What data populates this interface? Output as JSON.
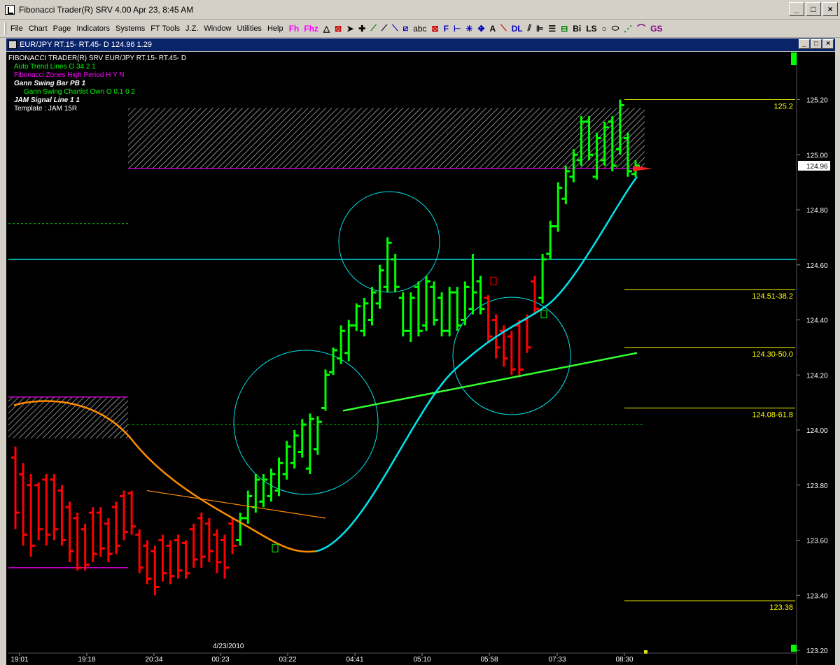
{
  "window": {
    "title": "Fibonacci Trader(R) SRV 4.00 Apr 23,  8:45 AM",
    "buttons": [
      "_",
      "□",
      "×"
    ]
  },
  "menu": {
    "items": [
      "File",
      "Chart",
      "Page",
      "Indicators",
      "Systems",
      "FT Tools",
      "J.Z.",
      "Window",
      "Utilities",
      "Help"
    ],
    "tools": [
      "Fh",
      "Fhz",
      "abc",
      "F",
      "A",
      "DL",
      "Bi",
      "LS",
      "GS"
    ]
  },
  "child_window": {
    "title": "EUR/JPY RT.15- RT.45- D  124.96  1.29"
  },
  "legend": {
    "header": "FIBONACCI TRADER(R) SRV    EUR/JPY RT.15- RT.45- D",
    "lines": [
      {
        "text": "Auto Trend Lines O 34 2 1",
        "color": "#00ff00"
      },
      {
        "text": "Fibonacci Zones High Period H Y N",
        "color": "#ff00ff"
      },
      {
        "text": "Gann Swing Bar PB 1",
        "color": "#ffffff"
      },
      {
        "text": "Gann Swing Chartist Own O 0.1 0 2",
        "color": "#00ff00"
      },
      {
        "text": "JAM Signal Line 1 1",
        "color": "#ffffff"
      },
      {
        "text": "Template : JAM 15R",
        "color": "#ffffff"
      }
    ]
  },
  "chart_data": {
    "type": "bar",
    "title": "",
    "ylim": [
      123.2,
      125.28
    ],
    "y_ticks": [
      "125.20",
      "125.00",
      "124.80",
      "124.60",
      "124.40",
      "124.20",
      "124.00",
      "123.80",
      "123.60",
      "123.40",
      "123.20"
    ],
    "x_ticks": [
      "19:01",
      "19:18",
      "20:34",
      "00:23",
      "03:22",
      "04:41",
      "05:10",
      "05:58",
      "07:33",
      "08:30"
    ],
    "date_label": "4/23/2010",
    "current_price": "124.96",
    "fib_levels": [
      {
        "label": "125.2",
        "value": 125.2
      },
      {
        "label": "124.51-38.2",
        "value": 124.51
      },
      {
        "label": "124.30-50.0",
        "value": 124.3
      },
      {
        "label": "124.08-61.8",
        "value": 124.08
      },
      {
        "label": "123.38",
        "value": 123.38
      }
    ],
    "horizontal_line": 124.62,
    "colors": {
      "up": "#00ff00",
      "down": "#ff0000",
      "signal": "#00e5ee",
      "orange": "#ff8c00",
      "fib": "#ffff00"
    },
    "bars": [
      {
        "h": 123.94,
        "l": 123.64,
        "o": 123.9,
        "c": 123.7,
        "color": "down"
      },
      {
        "h": 123.88,
        "l": 123.58,
        "o": 123.84,
        "c": 123.62,
        "color": "down"
      },
      {
        "h": 123.84,
        "l": 123.54,
        "o": 123.8,
        "c": 123.58,
        "color": "down"
      },
      {
        "h": 123.81,
        "l": 123.6,
        "o": 123.8,
        "c": 123.64,
        "color": "down"
      },
      {
        "h": 123.84,
        "l": 123.58,
        "o": 123.82,
        "c": 123.62,
        "color": "down"
      },
      {
        "h": 123.84,
        "l": 123.6,
        "o": 123.82,
        "c": 123.64,
        "color": "down"
      },
      {
        "h": 123.8,
        "l": 123.58,
        "o": 123.78,
        "c": 123.6,
        "color": "down"
      },
      {
        "h": 123.74,
        "l": 123.52,
        "o": 123.72,
        "c": 123.56,
        "color": "down"
      },
      {
        "h": 123.7,
        "l": 123.49,
        "o": 123.68,
        "c": 123.5,
        "color": "down"
      },
      {
        "h": 123.66,
        "l": 123.49,
        "o": 123.64,
        "c": 123.51,
        "color": "down"
      },
      {
        "h": 123.72,
        "l": 123.52,
        "o": 123.7,
        "c": 123.55,
        "color": "down"
      },
      {
        "h": 123.72,
        "l": 123.54,
        "o": 123.7,
        "c": 123.57,
        "color": "down"
      },
      {
        "h": 123.68,
        "l": 123.52,
        "o": 123.66,
        "c": 123.55,
        "color": "down"
      },
      {
        "h": 123.74,
        "l": 123.55,
        "o": 123.72,
        "c": 123.58,
        "color": "down"
      },
      {
        "h": 123.78,
        "l": 123.6,
        "o": 123.76,
        "c": 123.63,
        "color": "down"
      },
      {
        "h": 123.78,
        "l": 123.62,
        "o": 123.77,
        "c": 123.65,
        "color": "down"
      },
      {
        "h": 123.64,
        "l": 123.48,
        "o": 123.62,
        "c": 123.5,
        "color": "down"
      },
      {
        "h": 123.6,
        "l": 123.44,
        "o": 123.58,
        "c": 123.46,
        "color": "down"
      },
      {
        "h": 123.58,
        "l": 123.4,
        "o": 123.56,
        "c": 123.43,
        "color": "down"
      },
      {
        "h": 123.62,
        "l": 123.45,
        "o": 123.6,
        "c": 123.48,
        "color": "down"
      },
      {
        "h": 123.6,
        "l": 123.44,
        "o": 123.58,
        "c": 123.47,
        "color": "down"
      },
      {
        "h": 123.62,
        "l": 123.46,
        "o": 123.6,
        "c": 123.49,
        "color": "down"
      },
      {
        "h": 123.6,
        "l": 123.46,
        "o": 123.59,
        "c": 123.48,
        "color": "down"
      },
      {
        "h": 123.66,
        "l": 123.5,
        "o": 123.64,
        "c": 123.53,
        "color": "down"
      },
      {
        "h": 123.7,
        "l": 123.5,
        "o": 123.68,
        "c": 123.54,
        "color": "down"
      },
      {
        "h": 123.68,
        "l": 123.52,
        "o": 123.66,
        "c": 123.56,
        "color": "down"
      },
      {
        "h": 123.64,
        "l": 123.48,
        "o": 123.62,
        "c": 123.52,
        "color": "down"
      },
      {
        "h": 123.62,
        "l": 123.46,
        "o": 123.6,
        "c": 123.5,
        "color": "down"
      },
      {
        "h": 123.68,
        "l": 123.55,
        "o": 123.66,
        "c": 123.58,
        "color": "down"
      },
      {
        "h": 123.7,
        "l": 123.58,
        "o": 123.6,
        "c": 123.68,
        "color": "up"
      },
      {
        "h": 123.78,
        "l": 123.66,
        "o": 123.68,
        "c": 123.76,
        "color": "up"
      },
      {
        "h": 123.84,
        "l": 123.7,
        "o": 123.72,
        "c": 123.82,
        "color": "up"
      },
      {
        "h": 123.84,
        "l": 123.72,
        "o": 123.74,
        "c": 123.82,
        "color": "up"
      },
      {
        "h": 123.86,
        "l": 123.74,
        "o": 123.76,
        "c": 123.84,
        "color": "up"
      },
      {
        "h": 123.9,
        "l": 123.76,
        "o": 123.78,
        "c": 123.88,
        "color": "up"
      },
      {
        "h": 123.96,
        "l": 123.82,
        "o": 123.84,
        "c": 123.94,
        "color": "up"
      },
      {
        "h": 124.0,
        "l": 123.86,
        "o": 123.88,
        "c": 123.98,
        "color": "up"
      },
      {
        "h": 124.04,
        "l": 123.9,
        "o": 123.92,
        "c": 124.02,
        "color": "up"
      },
      {
        "h": 124.06,
        "l": 123.84,
        "o": 123.86,
        "c": 124.04,
        "color": "up"
      },
      {
        "h": 124.05,
        "l": 123.91,
        "o": 123.93,
        "c": 124.03,
        "color": "up"
      },
      {
        "h": 124.22,
        "l": 124.07,
        "o": 124.08,
        "c": 124.2,
        "color": "up"
      },
      {
        "h": 124.3,
        "l": 124.2,
        "o": 124.21,
        "c": 124.29,
        "color": "up"
      },
      {
        "h": 124.38,
        "l": 124.24,
        "o": 124.26,
        "c": 124.36,
        "color": "up"
      },
      {
        "h": 124.4,
        "l": 124.25,
        "o": 124.28,
        "c": 124.38,
        "color": "up"
      },
      {
        "h": 124.46,
        "l": 124.36,
        "o": 124.38,
        "c": 124.45,
        "color": "up"
      },
      {
        "h": 124.48,
        "l": 124.34,
        "o": 124.36,
        "c": 124.46,
        "color": "up"
      },
      {
        "h": 124.52,
        "l": 124.38,
        "o": 124.4,
        "c": 124.5,
        "color": "up"
      },
      {
        "h": 124.6,
        "l": 124.44,
        "o": 124.46,
        "c": 124.58,
        "color": "up"
      },
      {
        "h": 124.7,
        "l": 124.5,
        "o": 124.52,
        "c": 124.68,
        "color": "up"
      },
      {
        "h": 124.64,
        "l": 124.5,
        "o": 124.62,
        "c": 124.52,
        "color": "up"
      },
      {
        "h": 124.5,
        "l": 124.34,
        "o": 124.48,
        "c": 124.36,
        "color": "up"
      },
      {
        "h": 124.5,
        "l": 124.32,
        "o": 124.36,
        "c": 124.48,
        "color": "up"
      },
      {
        "h": 124.54,
        "l": 124.34,
        "o": 124.52,
        "c": 124.36,
        "color": "up"
      },
      {
        "h": 124.56,
        "l": 124.36,
        "o": 124.38,
        "c": 124.54,
        "color": "up"
      },
      {
        "h": 124.54,
        "l": 124.38,
        "o": 124.52,
        "c": 124.4,
        "color": "up"
      },
      {
        "h": 124.5,
        "l": 124.34,
        "o": 124.48,
        "c": 124.36,
        "color": "up"
      },
      {
        "h": 124.52,
        "l": 124.34,
        "o": 124.36,
        "c": 124.5,
        "color": "up"
      },
      {
        "h": 124.52,
        "l": 124.36,
        "o": 124.5,
        "c": 124.38,
        "color": "up"
      },
      {
        "h": 124.54,
        "l": 124.38,
        "o": 124.4,
        "c": 124.52,
        "color": "up"
      },
      {
        "h": 124.64,
        "l": 124.42,
        "o": 124.44,
        "c": 124.5,
        "color": "up"
      },
      {
        "h": 124.56,
        "l": 124.42,
        "o": 124.54,
        "c": 124.44,
        "color": "up"
      },
      {
        "h": 124.49,
        "l": 124.32,
        "o": 124.48,
        "c": 124.34,
        "color": "down"
      },
      {
        "h": 124.42,
        "l": 124.26,
        "o": 124.4,
        "c": 124.3,
        "color": "down"
      },
      {
        "h": 124.38,
        "l": 124.23,
        "o": 124.36,
        "c": 124.26,
        "color": "down"
      },
      {
        "h": 124.36,
        "l": 124.2,
        "o": 124.34,
        "c": 124.22,
        "color": "down"
      },
      {
        "h": 124.4,
        "l": 124.2,
        "o": 124.38,
        "c": 124.22,
        "color": "down"
      },
      {
        "h": 124.42,
        "l": 124.28,
        "o": 124.4,
        "c": 124.3,
        "color": "down"
      },
      {
        "h": 124.56,
        "l": 124.42,
        "o": 124.54,
        "c": 124.44,
        "color": "down"
      },
      {
        "h": 124.64,
        "l": 124.46,
        "o": 124.48,
        "c": 124.62,
        "color": "up"
      },
      {
        "h": 124.76,
        "l": 124.62,
        "o": 124.64,
        "c": 124.74,
        "color": "up"
      },
      {
        "h": 124.9,
        "l": 124.72,
        "o": 124.74,
        "c": 124.88,
        "color": "up"
      },
      {
        "h": 124.96,
        "l": 124.82,
        "o": 124.84,
        "c": 124.94,
        "color": "up"
      },
      {
        "h": 125.02,
        "l": 124.9,
        "o": 124.92,
        "c": 125.0,
        "color": "up"
      },
      {
        "h": 125.14,
        "l": 124.96,
        "o": 124.98,
        "c": 125.12,
        "color": "up"
      },
      {
        "h": 125.14,
        "l": 124.98,
        "o": 125.12,
        "c": 125.0,
        "color": "up"
      },
      {
        "h": 125.08,
        "l": 124.91,
        "o": 124.92,
        "c": 125.06,
        "color": "up"
      },
      {
        "h": 125.12,
        "l": 124.96,
        "o": 124.98,
        "c": 125.1,
        "color": "up"
      },
      {
        "h": 125.14,
        "l": 124.94,
        "o": 125.12,
        "c": 124.96,
        "color": "up"
      },
      {
        "h": 125.2,
        "l": 125.0,
        "o": 125.02,
        "c": 125.18,
        "color": "up"
      },
      {
        "h": 125.08,
        "l": 124.92,
        "o": 125.06,
        "c": 124.94,
        "color": "up"
      },
      {
        "h": 124.98,
        "l": 124.92,
        "o": 124.93,
        "c": 124.96,
        "color": "up"
      }
    ]
  }
}
